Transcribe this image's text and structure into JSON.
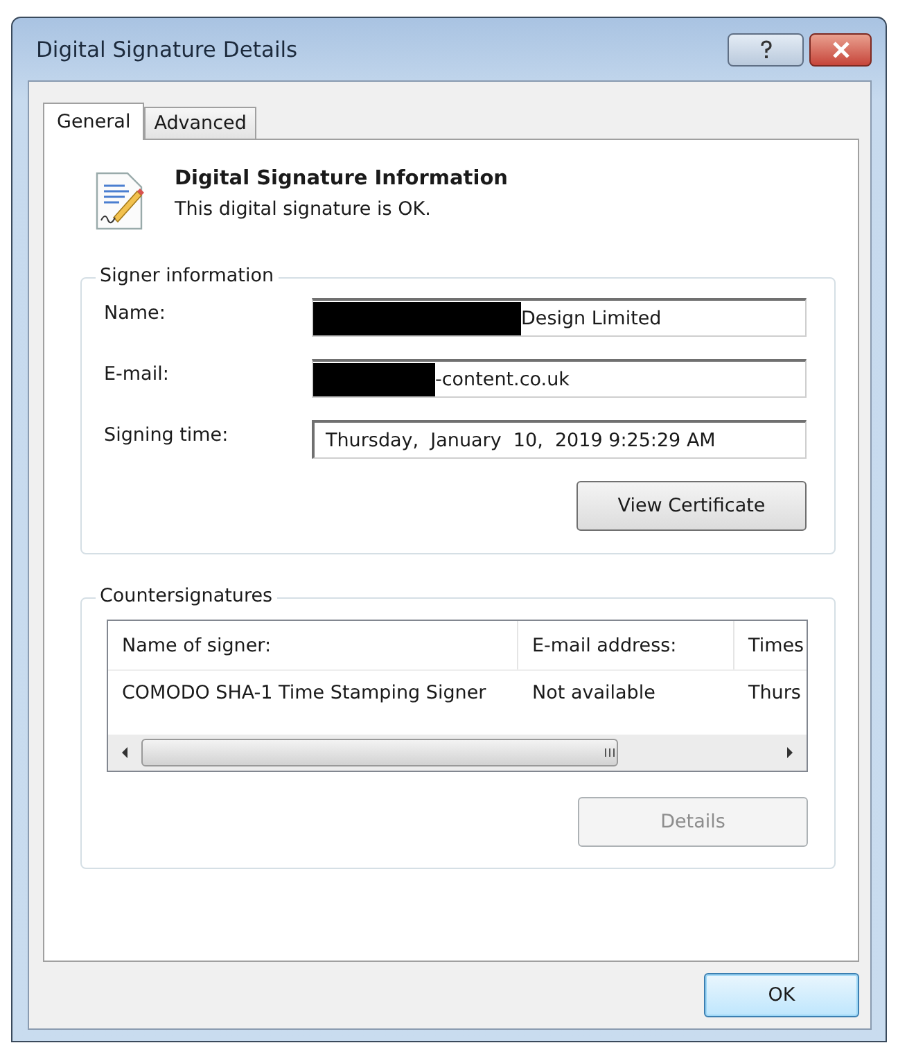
{
  "window": {
    "title": "Digital Signature Details"
  },
  "tabs": [
    {
      "label": "General",
      "selected": true
    },
    {
      "label": "Advanced",
      "selected": false
    }
  ],
  "header": {
    "title": "Digital Signature Information",
    "status": "This digital signature is OK."
  },
  "signer_information": {
    "title": "Signer information",
    "fields": [
      {
        "label": "Name:",
        "value": "Design Limited",
        "redacted": true
      },
      {
        "label": "E-mail:",
        "value": "-content.co.uk",
        "redacted": true
      },
      {
        "label": "Signing time:",
        "value": "Thursday,  January  10,  2019 9:25:29 AM",
        "redacted": false
      }
    ],
    "button": {
      "label": "View Certificate",
      "disabled": false
    }
  },
  "countersignatures": {
    "title": "Countersignatures",
    "table": {
      "columns": [
        "Name of signer:",
        "E-mail address:",
        "Times"
      ],
      "rows": [
        [
          "COMODO SHA-1 Time Stamping Signer",
          "Not available",
          "Thurs"
        ]
      ]
    },
    "button": {
      "label": "Details",
      "disabled": true
    }
  },
  "buttons": [
    {
      "label": "OK",
      "disabled": false
    }
  ]
}
